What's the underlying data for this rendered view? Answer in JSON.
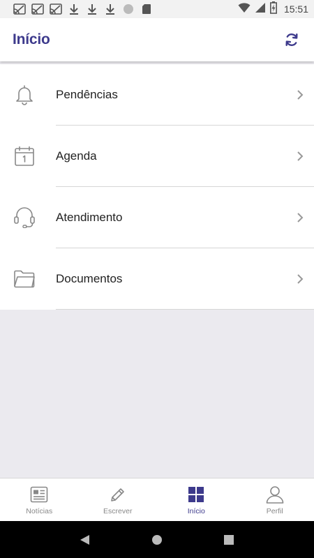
{
  "status_bar": {
    "time": "15:51",
    "icons": [
      "cast-icon",
      "cast-icon",
      "cast-icon",
      "download-icon",
      "download-icon",
      "download-icon",
      "dot-icon",
      "sd-card-icon",
      "wifi-icon",
      "signal-icon",
      "battery-charging-icon"
    ]
  },
  "header": {
    "title": "Início",
    "refresh_icon": "refresh-icon"
  },
  "menu": {
    "items": [
      {
        "label": "Pendências",
        "icon": "bell-icon"
      },
      {
        "label": "Agenda",
        "icon": "calendar-icon"
      },
      {
        "label": "Atendimento",
        "icon": "headset-icon"
      },
      {
        "label": "Documentos",
        "icon": "folder-icon"
      }
    ]
  },
  "bottom_nav": {
    "items": [
      {
        "label": "Notícias",
        "icon": "news-icon"
      },
      {
        "label": "Escrever",
        "icon": "pencil-icon"
      },
      {
        "label": "Início",
        "icon": "grid-icon",
        "active": true
      },
      {
        "label": "Perfil",
        "icon": "user-icon"
      }
    ]
  },
  "colors": {
    "accent": "#3d3a8c",
    "background": "#ebeaef",
    "icon_gray": "#888888"
  }
}
